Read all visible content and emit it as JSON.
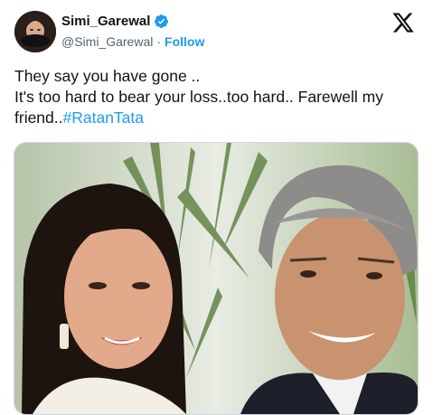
{
  "author": {
    "display_name": "Simi_Garewal",
    "handle": "@Simi_Garewal",
    "separator": "·",
    "follow_label": "Follow",
    "verified": true,
    "avatar_icon": "profile-photo"
  },
  "platform": {
    "logo_icon": "x-logo-icon"
  },
  "tweet": {
    "line1": "They say you have gone ..",
    "line2": "It's too hard to bear your loss..too hard.. Farewell my friend..",
    "hashtag": "#RatanTata"
  },
  "media": {
    "type": "photo",
    "subject": "two people smiling"
  },
  "colors": {
    "accent": "#1d9bf0",
    "text": "#0f1419",
    "muted": "#536471"
  }
}
